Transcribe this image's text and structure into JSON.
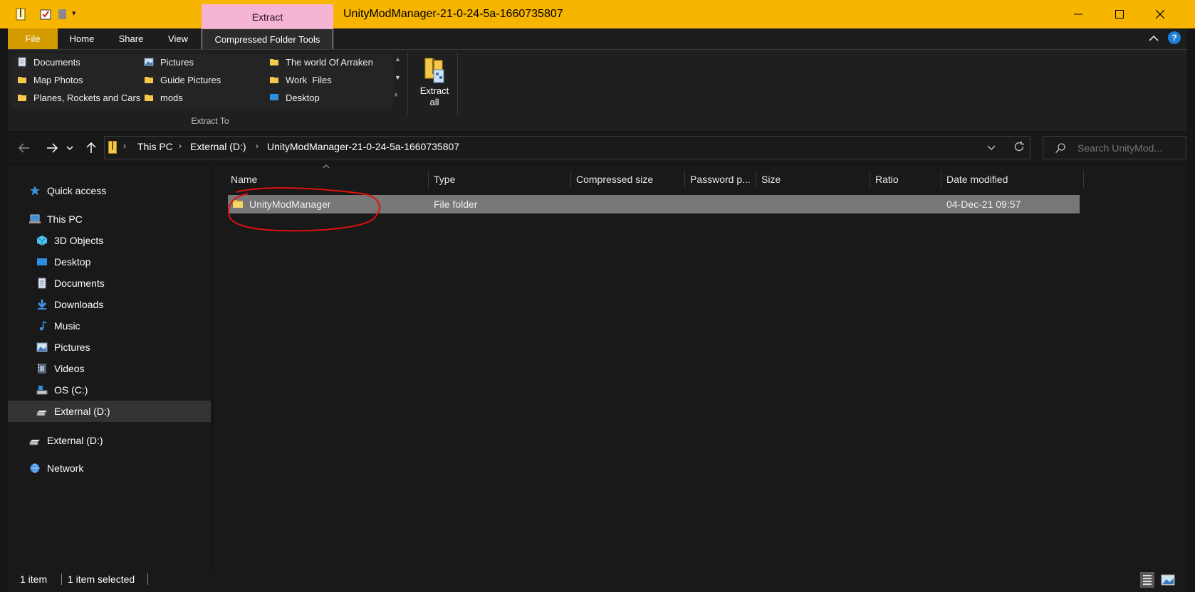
{
  "window": {
    "title": "UnityModManager-21-0-24-5a-1660735807",
    "context_tab": "Extract",
    "accent": "#f7b500"
  },
  "ribbon_tabs": {
    "file": "File",
    "home": "Home",
    "share": "Share",
    "view": "View",
    "compressed": "Compressed Folder Tools"
  },
  "ribbon": {
    "destinations": [
      {
        "label": "Documents",
        "icon": "documents-icon"
      },
      {
        "label": "Map Photos",
        "icon": "folder-icon"
      },
      {
        "label": "Planes, Rockets and Cars",
        "icon": "folder-icon"
      },
      {
        "label": "Pictures",
        "icon": "pictures-icon"
      },
      {
        "label": "Guide Pictures",
        "icon": "folder-icon"
      },
      {
        "label": "mods",
        "icon": "folder-icon"
      },
      {
        "label": "The world Of Arraken",
        "icon": "folder-icon"
      },
      {
        "label": "Work  Files",
        "icon": "folder-icon"
      },
      {
        "label": "Desktop",
        "icon": "desktop-icon"
      }
    ],
    "group_label": "Extract To",
    "extract_all": "Extract all"
  },
  "address": {
    "crumbs": [
      "This PC",
      "External (D:)",
      "UnityModManager-21-0-24-5a-1660735807"
    ]
  },
  "search": {
    "placeholder": "Search UnityMod..."
  },
  "sidebar": {
    "items": [
      {
        "label": "Quick access",
        "icon": "star-icon"
      },
      {
        "label": "This PC",
        "icon": "computer-icon"
      },
      {
        "label": "3D Objects",
        "icon": "cube-icon"
      },
      {
        "label": "Desktop",
        "icon": "desktop-icon"
      },
      {
        "label": "Documents",
        "icon": "documents-icon"
      },
      {
        "label": "Downloads",
        "icon": "download-icon"
      },
      {
        "label": "Music",
        "icon": "music-icon"
      },
      {
        "label": "Pictures",
        "icon": "pictures-icon"
      },
      {
        "label": "Videos",
        "icon": "videos-icon"
      },
      {
        "label": "OS (C:)",
        "icon": "drive-icon"
      },
      {
        "label": "External (D:)",
        "icon": "drive-icon"
      },
      {
        "label": "External (D:)",
        "icon": "drive-icon"
      },
      {
        "label": "Network",
        "icon": "network-icon"
      }
    ]
  },
  "columns": {
    "name": "Name",
    "type": "Type",
    "compressed_size": "Compressed size",
    "password": "Password p...",
    "size": "Size",
    "ratio": "Ratio",
    "date_modified": "Date modified"
  },
  "files": [
    {
      "name": "UnityModManager",
      "type": "File folder",
      "date_modified": "04-Dec-21 09:57"
    }
  ],
  "status": {
    "count": "1 item",
    "selected": "1 item selected"
  }
}
